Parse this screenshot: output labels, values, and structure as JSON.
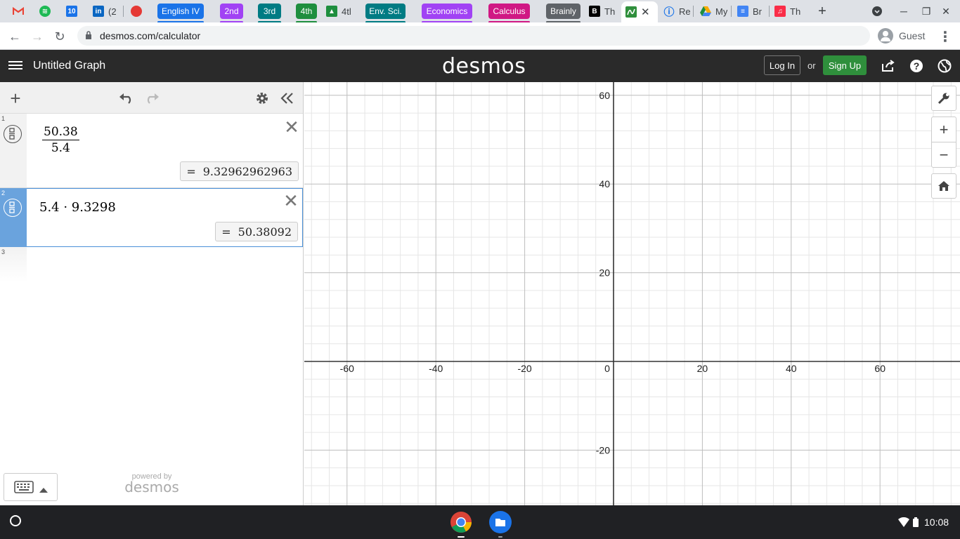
{
  "browser": {
    "tabs": [
      {
        "title": "",
        "icon": "gmail-icon",
        "color": "#ea4335"
      },
      {
        "title": "",
        "icon": "spotify-icon",
        "color": "#1db954"
      },
      {
        "title": "",
        "icon": "calendar-icon",
        "color": "#1a73e8"
      },
      {
        "title": "(2",
        "icon": "linkedin-icon",
        "color": "#0a66c2"
      },
      {
        "title": "",
        "icon": "record-icon",
        "color": "#e53935"
      }
    ],
    "groups": [
      {
        "label": "English IV",
        "color": "#1a73e8"
      },
      {
        "label": "2nd",
        "color": "#a142f4"
      },
      {
        "label": "3rd",
        "color": "#007b83"
      },
      {
        "label": "4th",
        "color": "#1e8e3e"
      },
      {
        "label": "Env. Sci.",
        "color": "#007b83"
      },
      {
        "label": "Economics",
        "color": "#a142f4"
      },
      {
        "label": "Calculus",
        "color": "#d01884"
      },
      {
        "label": "Brainly",
        "color": "#5f6368"
      }
    ],
    "classroom_tab_title": "4tl",
    "more_tabs": [
      {
        "title": "Th",
        "icon": "brainly-icon",
        "color": "#000000"
      },
      {
        "title": "Re",
        "icon": "info-icon",
        "color": "#1a73e8"
      },
      {
        "title": "My",
        "icon": "drive-icon",
        "color": "#f9ab00"
      },
      {
        "title": "Br",
        "icon": "docs-icon",
        "color": "#4285f4"
      },
      {
        "title": "Th",
        "icon": "music-icon",
        "color": "#fa2d48"
      }
    ],
    "url": "desmos.com/calculator",
    "profile_label": "Guest"
  },
  "app": {
    "graph_title": "Untitled Graph",
    "brand": "desmos",
    "login_label": "Log In",
    "or_label": "or",
    "signup_label": "Sign Up"
  },
  "expressions": [
    {
      "index": "1",
      "numerator": "50.38",
      "denominator": "5.4",
      "result": "9.32962962963",
      "equals": "="
    },
    {
      "index": "2",
      "latex": "5.4 · 9.3298",
      "result": "50.38092",
      "equals": "="
    },
    {
      "index": "3"
    }
  ],
  "powered_by": {
    "line1": "powered by",
    "line2": "desmos"
  },
  "graph": {
    "x_ticks": [
      "-60",
      "-40",
      "-20",
      "0",
      "20",
      "40",
      "60"
    ],
    "y_ticks": [
      "60",
      "40",
      "20",
      "-20"
    ]
  },
  "shelf": {
    "time": "10:08"
  }
}
